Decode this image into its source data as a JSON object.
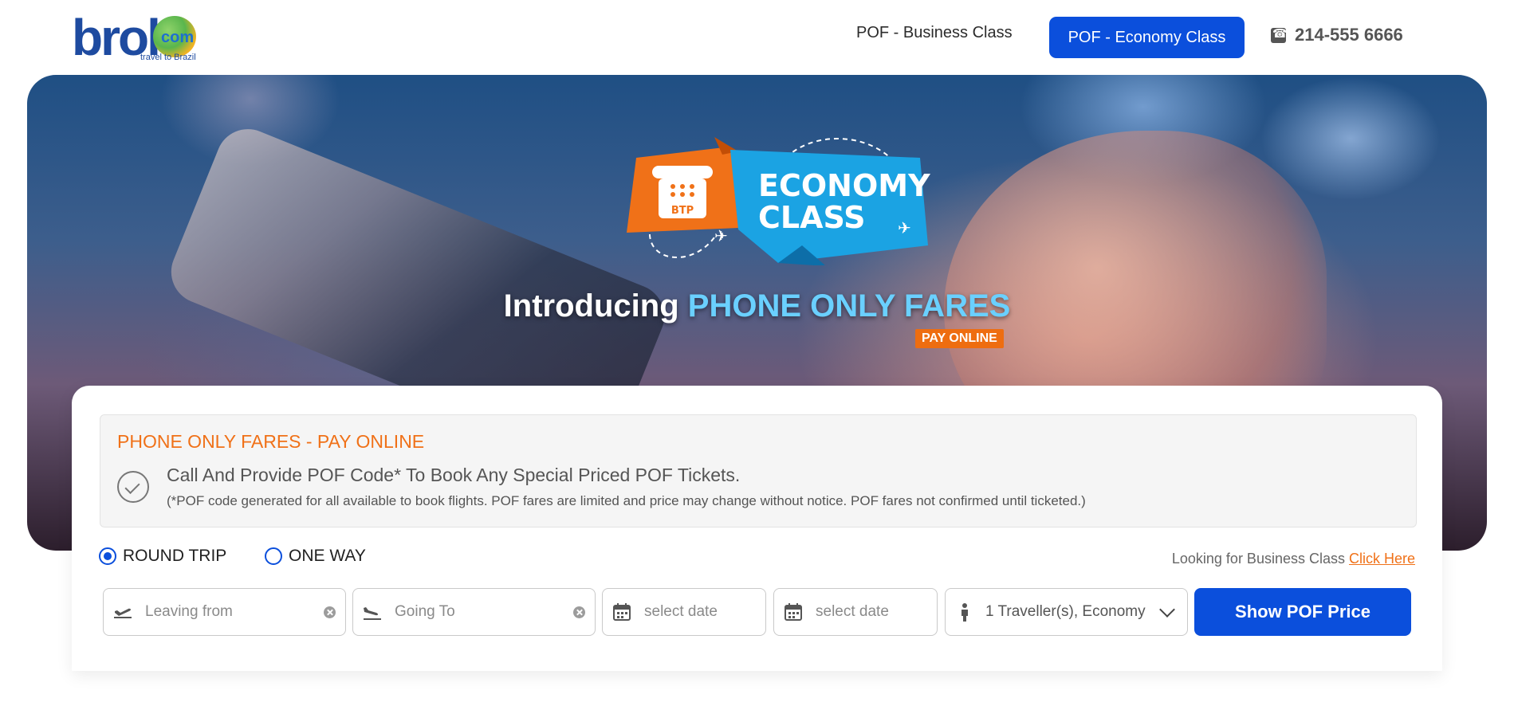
{
  "header": {
    "logo": {
      "brand": "brol",
      "com": "com",
      "tagline": "travel to Brazil"
    },
    "nav": {
      "business": "POF - Business Class",
      "economy": "POF - Economy Class"
    },
    "phone": "214-555 6666"
  },
  "hero": {
    "badge": {
      "line1": "ECONOMY",
      "line2": "CLASS",
      "logo_text": "BTP"
    },
    "headline_white": "Introducing",
    "headline_blue": "PHONE ONLY FARES",
    "pay_online": "PAY ONLINE"
  },
  "notice": {
    "title": "PHONE ONLY FARES - PAY ONLINE",
    "main": "Call And Provide POF Code* To Book Any Special Priced POF Tickets.",
    "sub": "(*POF code generated for all available to book flights. POF fares are limited and price may change without notice. POF fares not confirmed until ticketed.)"
  },
  "trip": {
    "round": "ROUND TRIP",
    "one_way": "ONE WAY",
    "selected": "round"
  },
  "business_prompt": {
    "text": "Looking for Business Class",
    "link": "Click Here"
  },
  "form": {
    "leaving_placeholder": "Leaving from",
    "going_placeholder": "Going To",
    "depart_placeholder": "select date",
    "return_placeholder": "select date",
    "travellers": "1 Traveller(s), Economy",
    "submit": "Show POF Price"
  },
  "colors": {
    "primary": "#0b4fdc",
    "accent": "#f07118"
  },
  "icons": {
    "from": "plane-takeoff-icon",
    "to": "plane-landing-icon",
    "date": "calendar-icon",
    "traveller": "person-icon",
    "clear": "clear-icon",
    "dropdown": "chevron-down-icon",
    "check": "check-circle-icon",
    "phone": "phone-icon"
  }
}
